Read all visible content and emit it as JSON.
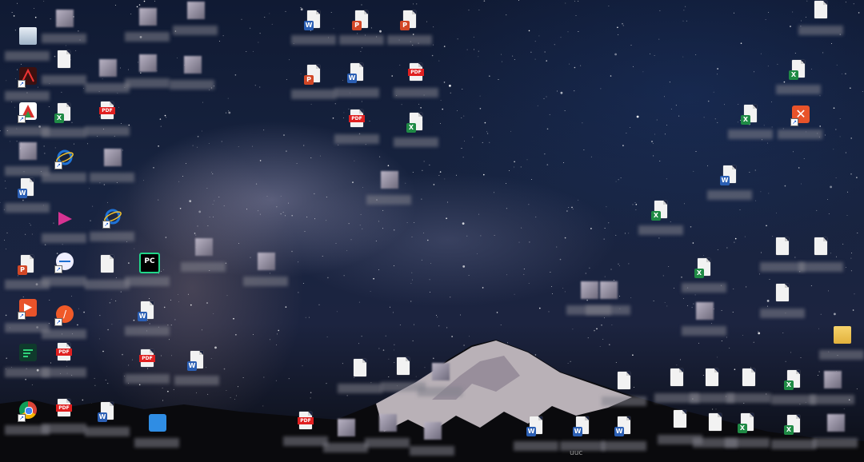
{
  "desktop": {
    "caption_bottom": "uuc",
    "icons": [
      {
        "name": "recycle-bin-icon",
        "kind": "bin"
      },
      {
        "name": "image-file-icon",
        "kind": "pix"
      },
      {
        "name": "chart-image-file-icon",
        "kind": "pix"
      },
      {
        "name": "red-app-file-icon",
        "kind": "pix"
      },
      {
        "name": "word-document-icon",
        "kind": "word"
      },
      {
        "name": "powerpoint-document-icon",
        "kind": "ppt"
      },
      {
        "name": "powerpoint-document-icon",
        "kind": "ppt"
      },
      {
        "name": "generic-file-icon",
        "kind": "doc"
      },
      {
        "name": "text-file-icon",
        "kind": "doc"
      },
      {
        "name": "blurred-file-icon",
        "kind": "pix"
      },
      {
        "name": "blurred-file-icon",
        "kind": "pix"
      },
      {
        "name": "image-file-icon",
        "kind": "pix"
      },
      {
        "name": "powerpoint-document-icon",
        "kind": "ppt"
      },
      {
        "name": "word-document-icon",
        "kind": "word"
      },
      {
        "name": "pdf-document-icon",
        "kind": "pdf"
      },
      {
        "name": "excel-spreadsheet-icon",
        "kind": "excel"
      },
      {
        "name": "acrobat-shortcut-icon",
        "kind": "acrobat"
      },
      {
        "name": "wps-shortcut-icon",
        "kind": "wps"
      },
      {
        "name": "excel-shortcut-icon",
        "kind": "excel"
      },
      {
        "name": "pdf-document-icon",
        "kind": "pdf"
      },
      {
        "name": "pdf-document-icon",
        "kind": "pdf"
      },
      {
        "name": "excel-spreadsheet-icon",
        "kind": "excel"
      },
      {
        "name": "excel-spreadsheet-icon",
        "kind": "excel"
      },
      {
        "name": "xmind-shortcut-icon",
        "kind": "orange-x"
      },
      {
        "name": "blurred-file-icon",
        "kind": "pix"
      },
      {
        "name": "ie-browser-icon",
        "kind": "ie"
      },
      {
        "name": "settings-image-icon",
        "kind": "pix"
      },
      {
        "name": "word-shortcut-icon",
        "kind": "word"
      },
      {
        "name": "word-document-icon",
        "kind": "word"
      },
      {
        "name": "image-file-icon",
        "kind": "pix"
      },
      {
        "name": "excel-shortcut-icon",
        "kind": "excel"
      },
      {
        "name": "magenta-app-icon",
        "kind": "magenta"
      },
      {
        "name": "ie-browser-icon",
        "kind": "ie"
      },
      {
        "name": "blurred-file-icon",
        "kind": "pix"
      },
      {
        "name": "generic-file-icon",
        "kind": "doc"
      },
      {
        "name": "generic-file-icon",
        "kind": "doc"
      },
      {
        "name": "powerpoint-shortcut-icon",
        "kind": "ppt"
      },
      {
        "name": "teamviewer-icon",
        "kind": "tv"
      },
      {
        "name": "generic-file-icon",
        "kind": "doc"
      },
      {
        "name": "pycharm-icon",
        "kind": "pycharm"
      },
      {
        "name": "blurred-file-icon",
        "kind": "pix"
      },
      {
        "name": "excel-spreadsheet-icon",
        "kind": "excel"
      },
      {
        "name": "image-file-icon",
        "kind": "pix"
      },
      {
        "name": "blurred-file-icon",
        "kind": "pix"
      },
      {
        "name": "generic-file-icon",
        "kind": "doc"
      },
      {
        "name": "foxit-reader-icon",
        "kind": "foxit"
      },
      {
        "name": "orange-app-icon",
        "kind": "orange-circle"
      },
      {
        "name": "word-document-icon",
        "kind": "word"
      },
      {
        "name": "image-file-icon",
        "kind": "pix"
      },
      {
        "name": "folder-icon",
        "kind": "folder"
      },
      {
        "name": "green-app-icon",
        "kind": "green-app"
      },
      {
        "name": "pdf-document-icon",
        "kind": "pdf"
      },
      {
        "name": "pdf-document-icon",
        "kind": "pdf"
      },
      {
        "name": "word-document-icon",
        "kind": "word"
      },
      {
        "name": "generic-file-icon",
        "kind": "doc"
      },
      {
        "name": "text-file-icon",
        "kind": "doc"
      },
      {
        "name": "pink-image-icon",
        "kind": "pix"
      },
      {
        "name": "generic-file-icon",
        "kind": "doc"
      },
      {
        "name": "generic-file-icon",
        "kind": "doc"
      },
      {
        "name": "generic-file-icon",
        "kind": "doc"
      },
      {
        "name": "generic-file-icon",
        "kind": "doc"
      },
      {
        "name": "excel-spreadsheet-icon",
        "kind": "excel"
      },
      {
        "name": "image-file-icon",
        "kind": "pix"
      },
      {
        "name": "chrome-browser-icon",
        "kind": "chrome"
      },
      {
        "name": "pdf-document-icon",
        "kind": "pdf"
      },
      {
        "name": "word-document-icon",
        "kind": "word"
      },
      {
        "name": "blue-file-icon",
        "kind": "blue"
      },
      {
        "name": "pdf-document-icon",
        "kind": "pdf"
      },
      {
        "name": "image-file-icon",
        "kind": "pix"
      },
      {
        "name": "table-file-icon",
        "kind": "pix"
      },
      {
        "name": "image-file-icon",
        "kind": "pix"
      },
      {
        "name": "word-document-icon",
        "kind": "word"
      },
      {
        "name": "word-document-icon",
        "kind": "word"
      },
      {
        "name": "word-document-icon",
        "kind": "word"
      },
      {
        "name": "text-file-icon",
        "kind": "doc"
      },
      {
        "name": "generic-file-icon",
        "kind": "doc"
      },
      {
        "name": "excel-spreadsheet-icon",
        "kind": "excel"
      },
      {
        "name": "excel-spreadsheet-icon",
        "kind": "excel"
      },
      {
        "name": "colorful-app-icon",
        "kind": "pix"
      }
    ]
  }
}
